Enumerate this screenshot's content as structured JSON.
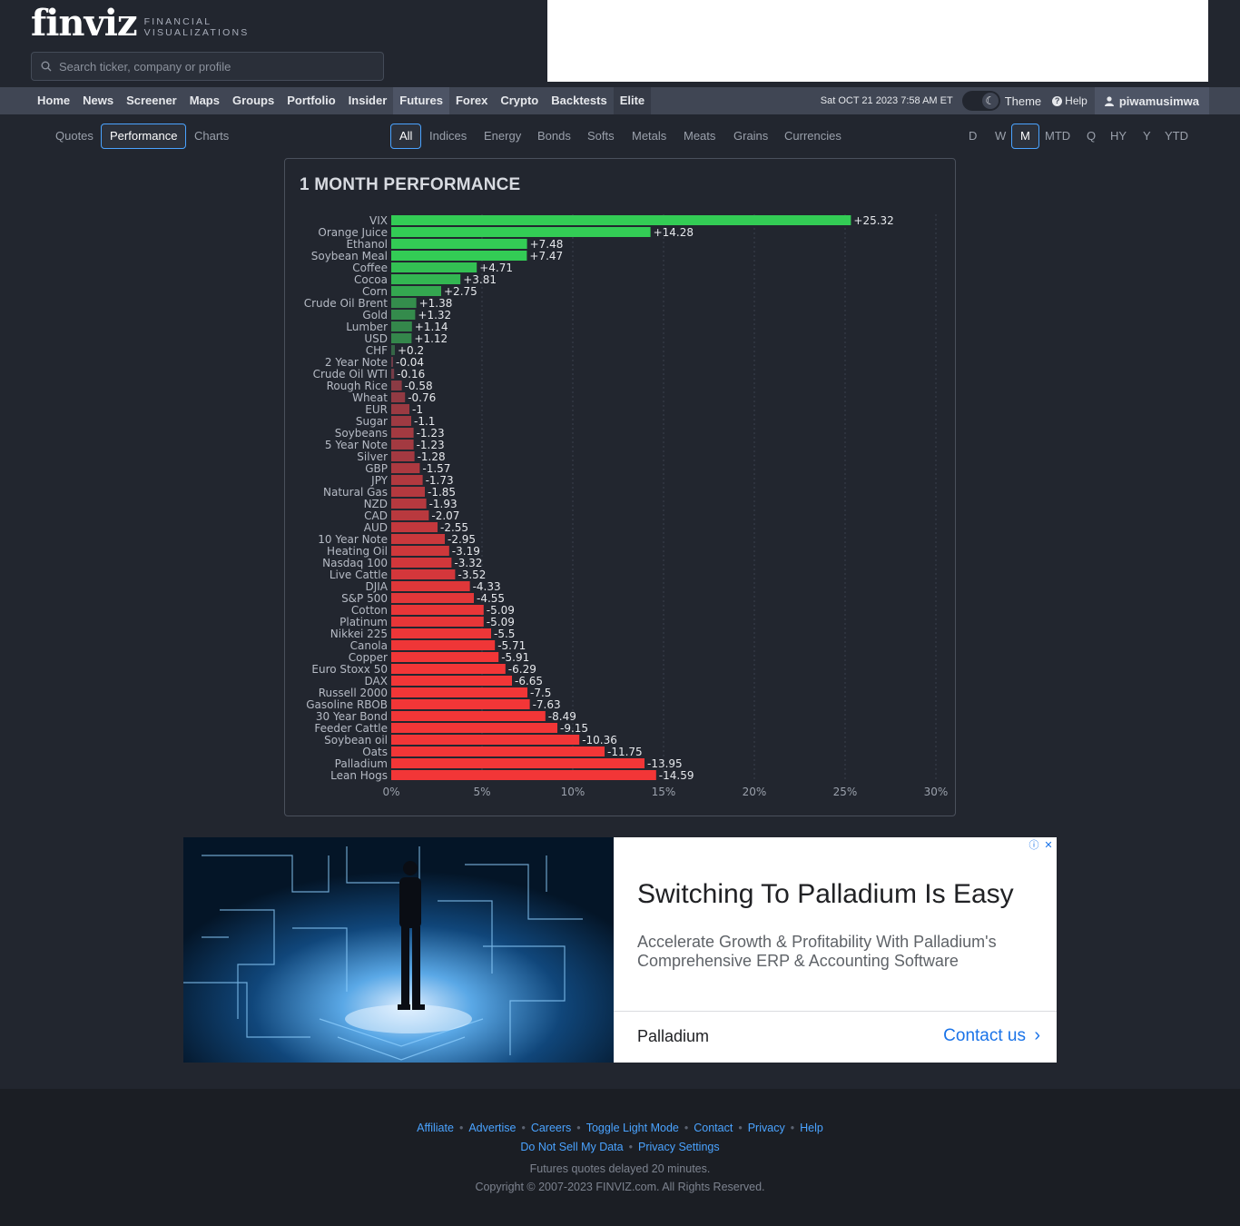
{
  "logo": {
    "word": "finviz",
    "sub_line1": "FINANCIAL",
    "sub_line2": "VISUALIZATIONS"
  },
  "search": {
    "placeholder": "Search ticker, company or profile"
  },
  "nav": {
    "items": [
      "Home",
      "News",
      "Screener",
      "Maps",
      "Groups",
      "Portfolio",
      "Insider",
      "Futures",
      "Forex",
      "Crypto",
      "Backtests",
      "Elite"
    ],
    "active": "Futures",
    "datetime": "Sat OCT 21 2023 7:58 AM ET",
    "theme_label": "Theme",
    "help_label": "Help",
    "username": "piwamusimwa"
  },
  "view_tabs": [
    "Quotes",
    "Performance",
    "Charts"
  ],
  "view_selected": "Performance",
  "category_tabs": [
    "All",
    "Indices",
    "Energy",
    "Bonds",
    "Softs",
    "Metals",
    "Meats",
    "Grains",
    "Currencies"
  ],
  "category_selected": "All",
  "period_tabs": [
    "D",
    "W",
    "M",
    "MTD",
    "Q",
    "HY",
    "Y",
    "YTD"
  ],
  "period_selected": "M",
  "colors": {
    "accent": "#4aa3ff",
    "up_strong": "#33cc55",
    "down_strong": "#f23637",
    "neutral": "#8b3c48"
  },
  "chart_title": "1 MONTH PERFORMANCE",
  "chart_data": {
    "type": "bar",
    "orientation": "horizontal",
    "title": "1 MONTH PERFORMANCE",
    "categories": [
      "VIX",
      "Orange Juice",
      "Ethanol",
      "Soybean Meal",
      "Coffee",
      "Cocoa",
      "Corn",
      "Crude Oil Brent",
      "Gold",
      "Lumber",
      "USD",
      "CHF",
      "2 Year Note",
      "Crude Oil WTI",
      "Rough Rice",
      "Wheat",
      "EUR",
      "Sugar",
      "Soybeans",
      "5 Year Note",
      "Silver",
      "GBP",
      "JPY",
      "Natural Gas",
      "NZD",
      "CAD",
      "AUD",
      "10 Year Note",
      "Heating Oil",
      "Nasdaq 100",
      "Live Cattle",
      "DJIA",
      "S&P 500",
      "Cotton",
      "Platinum",
      "Nikkei 225",
      "Canola",
      "Copper",
      "Euro Stoxx 50",
      "DAX",
      "Russell 2000",
      "Gasoline RBOB",
      "30 Year Bond",
      "Feeder Cattle",
      "Soybean oil",
      "Oats",
      "Palladium",
      "Lean Hogs"
    ],
    "values": [
      25.32,
      14.28,
      7.48,
      7.47,
      4.71,
      3.81,
      2.75,
      1.38,
      1.32,
      1.14,
      1.12,
      0.2,
      -0.04,
      -0.16,
      -0.58,
      -0.76,
      -1,
      -1.1,
      -1.23,
      -1.23,
      -1.28,
      -1.57,
      -1.73,
      -1.85,
      -1.93,
      -2.07,
      -2.55,
      -2.95,
      -3.19,
      -3.32,
      -3.52,
      -4.33,
      -4.55,
      -5.09,
      -5.09,
      -5.5,
      -5.71,
      -5.91,
      -6.29,
      -6.65,
      -7.5,
      -7.63,
      -8.49,
      -9.15,
      -10.36,
      -11.75,
      -13.95,
      -14.59
    ],
    "labels": [
      "+25.32",
      "+14.28",
      "+7.48",
      "+7.47",
      "+4.71",
      "+3.81",
      "+2.75",
      "+1.38",
      "+1.32",
      "+1.14",
      "+1.12",
      "+0.2",
      "-0.04",
      "-0.16",
      "-0.58",
      "-0.76",
      "-1",
      "-1.1",
      "-1.23",
      "-1.23",
      "-1.28",
      "-1.57",
      "-1.73",
      "-1.85",
      "-1.93",
      "-2.07",
      "-2.55",
      "-2.95",
      "-3.19",
      "-3.32",
      "-3.52",
      "-4.33",
      "-4.55",
      "-5.09",
      "-5.09",
      "-5.5",
      "-5.71",
      "-5.91",
      "-6.29",
      "-6.65",
      "-7.5",
      "-7.63",
      "-8.49",
      "-9.15",
      "-10.36",
      "-11.75",
      "-13.95",
      "-14.59"
    ],
    "xticks": [
      "0%",
      "5%",
      "10%",
      "15%",
      "20%",
      "25%",
      "30%"
    ],
    "xlim": [
      0,
      30
    ],
    "bar_length": "absolute value",
    "grid": true
  },
  "ad": {
    "headline": "Switching To Palladium Is Easy",
    "description": "Accelerate Growth & Profitability With Palladium's Comprehensive ERP & Accounting Software",
    "brand": "Palladium",
    "cta": "Contact us"
  },
  "footer": {
    "links_row1": [
      "Affiliate",
      "Advertise",
      "Careers",
      "Toggle Light Mode",
      "Contact",
      "Privacy",
      "Help"
    ],
    "links_row2": [
      "Do Not Sell My Data",
      "Privacy Settings"
    ],
    "note1": "Futures quotes delayed 20 minutes.",
    "note2": "Copyright © 2007-2023 FINVIZ.com. All Rights Reserved."
  }
}
